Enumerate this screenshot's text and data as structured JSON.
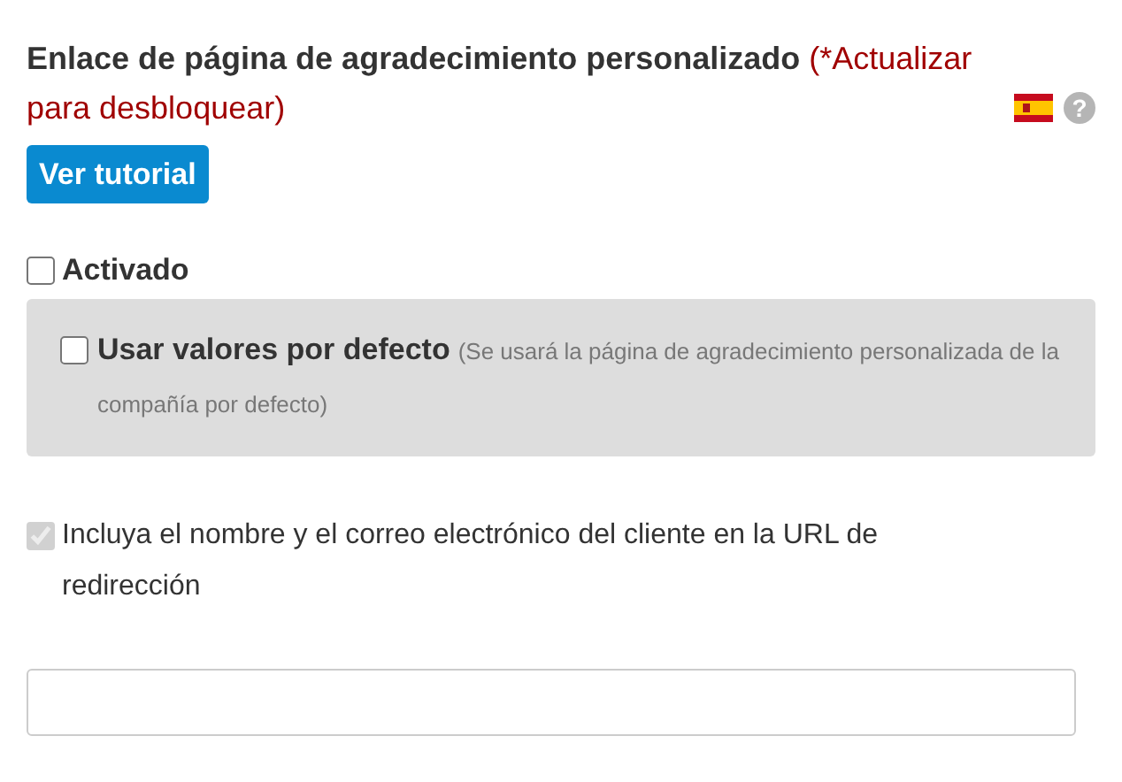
{
  "heading": {
    "title": "Enlace de página de agradecimiento personalizado",
    "upgrade_note": "(*Actualizar para desbloquear)",
    "help": "?"
  },
  "tutorial_button": "Ver tutorial",
  "enabled_option": {
    "label": "Activado",
    "checked": false
  },
  "defaults_option": {
    "label": "Usar valores por defecto",
    "note": "(Se usará la página de agradecimiento personalizada de la compañía por defecto)",
    "checked": false
  },
  "include_option": {
    "label": "Incluya el nombre y el correo electrónico del cliente en la URL de redirección",
    "checked": true,
    "disabled": true
  }
}
